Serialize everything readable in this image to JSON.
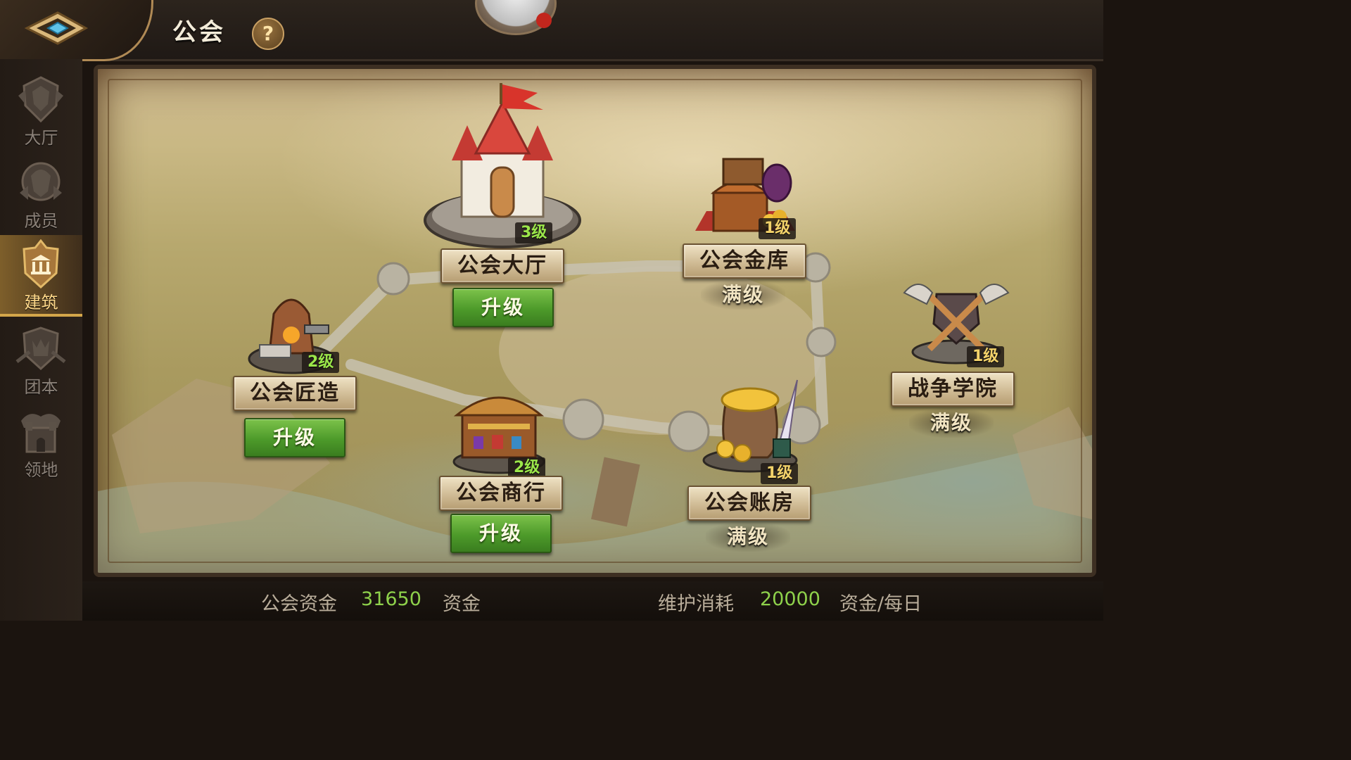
{
  "header": {
    "title": "公会",
    "help_icon": "?"
  },
  "sidebar": {
    "items": [
      {
        "label": "大厅",
        "icon": "hall-emblem-icon",
        "active": false
      },
      {
        "label": "成员",
        "icon": "members-emblem-icon",
        "active": false
      },
      {
        "label": "建筑",
        "icon": "building-emblem-icon",
        "active": true
      },
      {
        "label": "团本",
        "icon": "raid-emblem-icon",
        "active": false
      },
      {
        "label": "领地",
        "icon": "territory-emblem-icon",
        "active": false
      }
    ]
  },
  "buildings": {
    "hall": {
      "name": "公会大厅",
      "level": "3级",
      "action": "升级"
    },
    "treasury": {
      "name": "公会金库",
      "level": "1级",
      "status": "满级"
    },
    "smithy": {
      "name": "公会匠造",
      "level": "2级",
      "action": "升级"
    },
    "academy": {
      "name": "战争学院",
      "level": "1级",
      "status": "满级"
    },
    "market": {
      "name": "公会商行",
      "level": "2级",
      "action": "升级"
    },
    "accounts": {
      "name": "公会账房",
      "level": "1级",
      "status": "满级"
    }
  },
  "footer": {
    "funds_label": "公会资金",
    "funds_value": "31650",
    "funds_unit": "资金",
    "upkeep_label": "维护消耗",
    "upkeep_value": "20000",
    "upkeep_unit": "资金/每日"
  },
  "colors": {
    "accent_gold": "#d4a64a",
    "level_green": "#9be64a",
    "upgrade_green": "#4d9a2a",
    "value_green": "#8ed14b"
  }
}
